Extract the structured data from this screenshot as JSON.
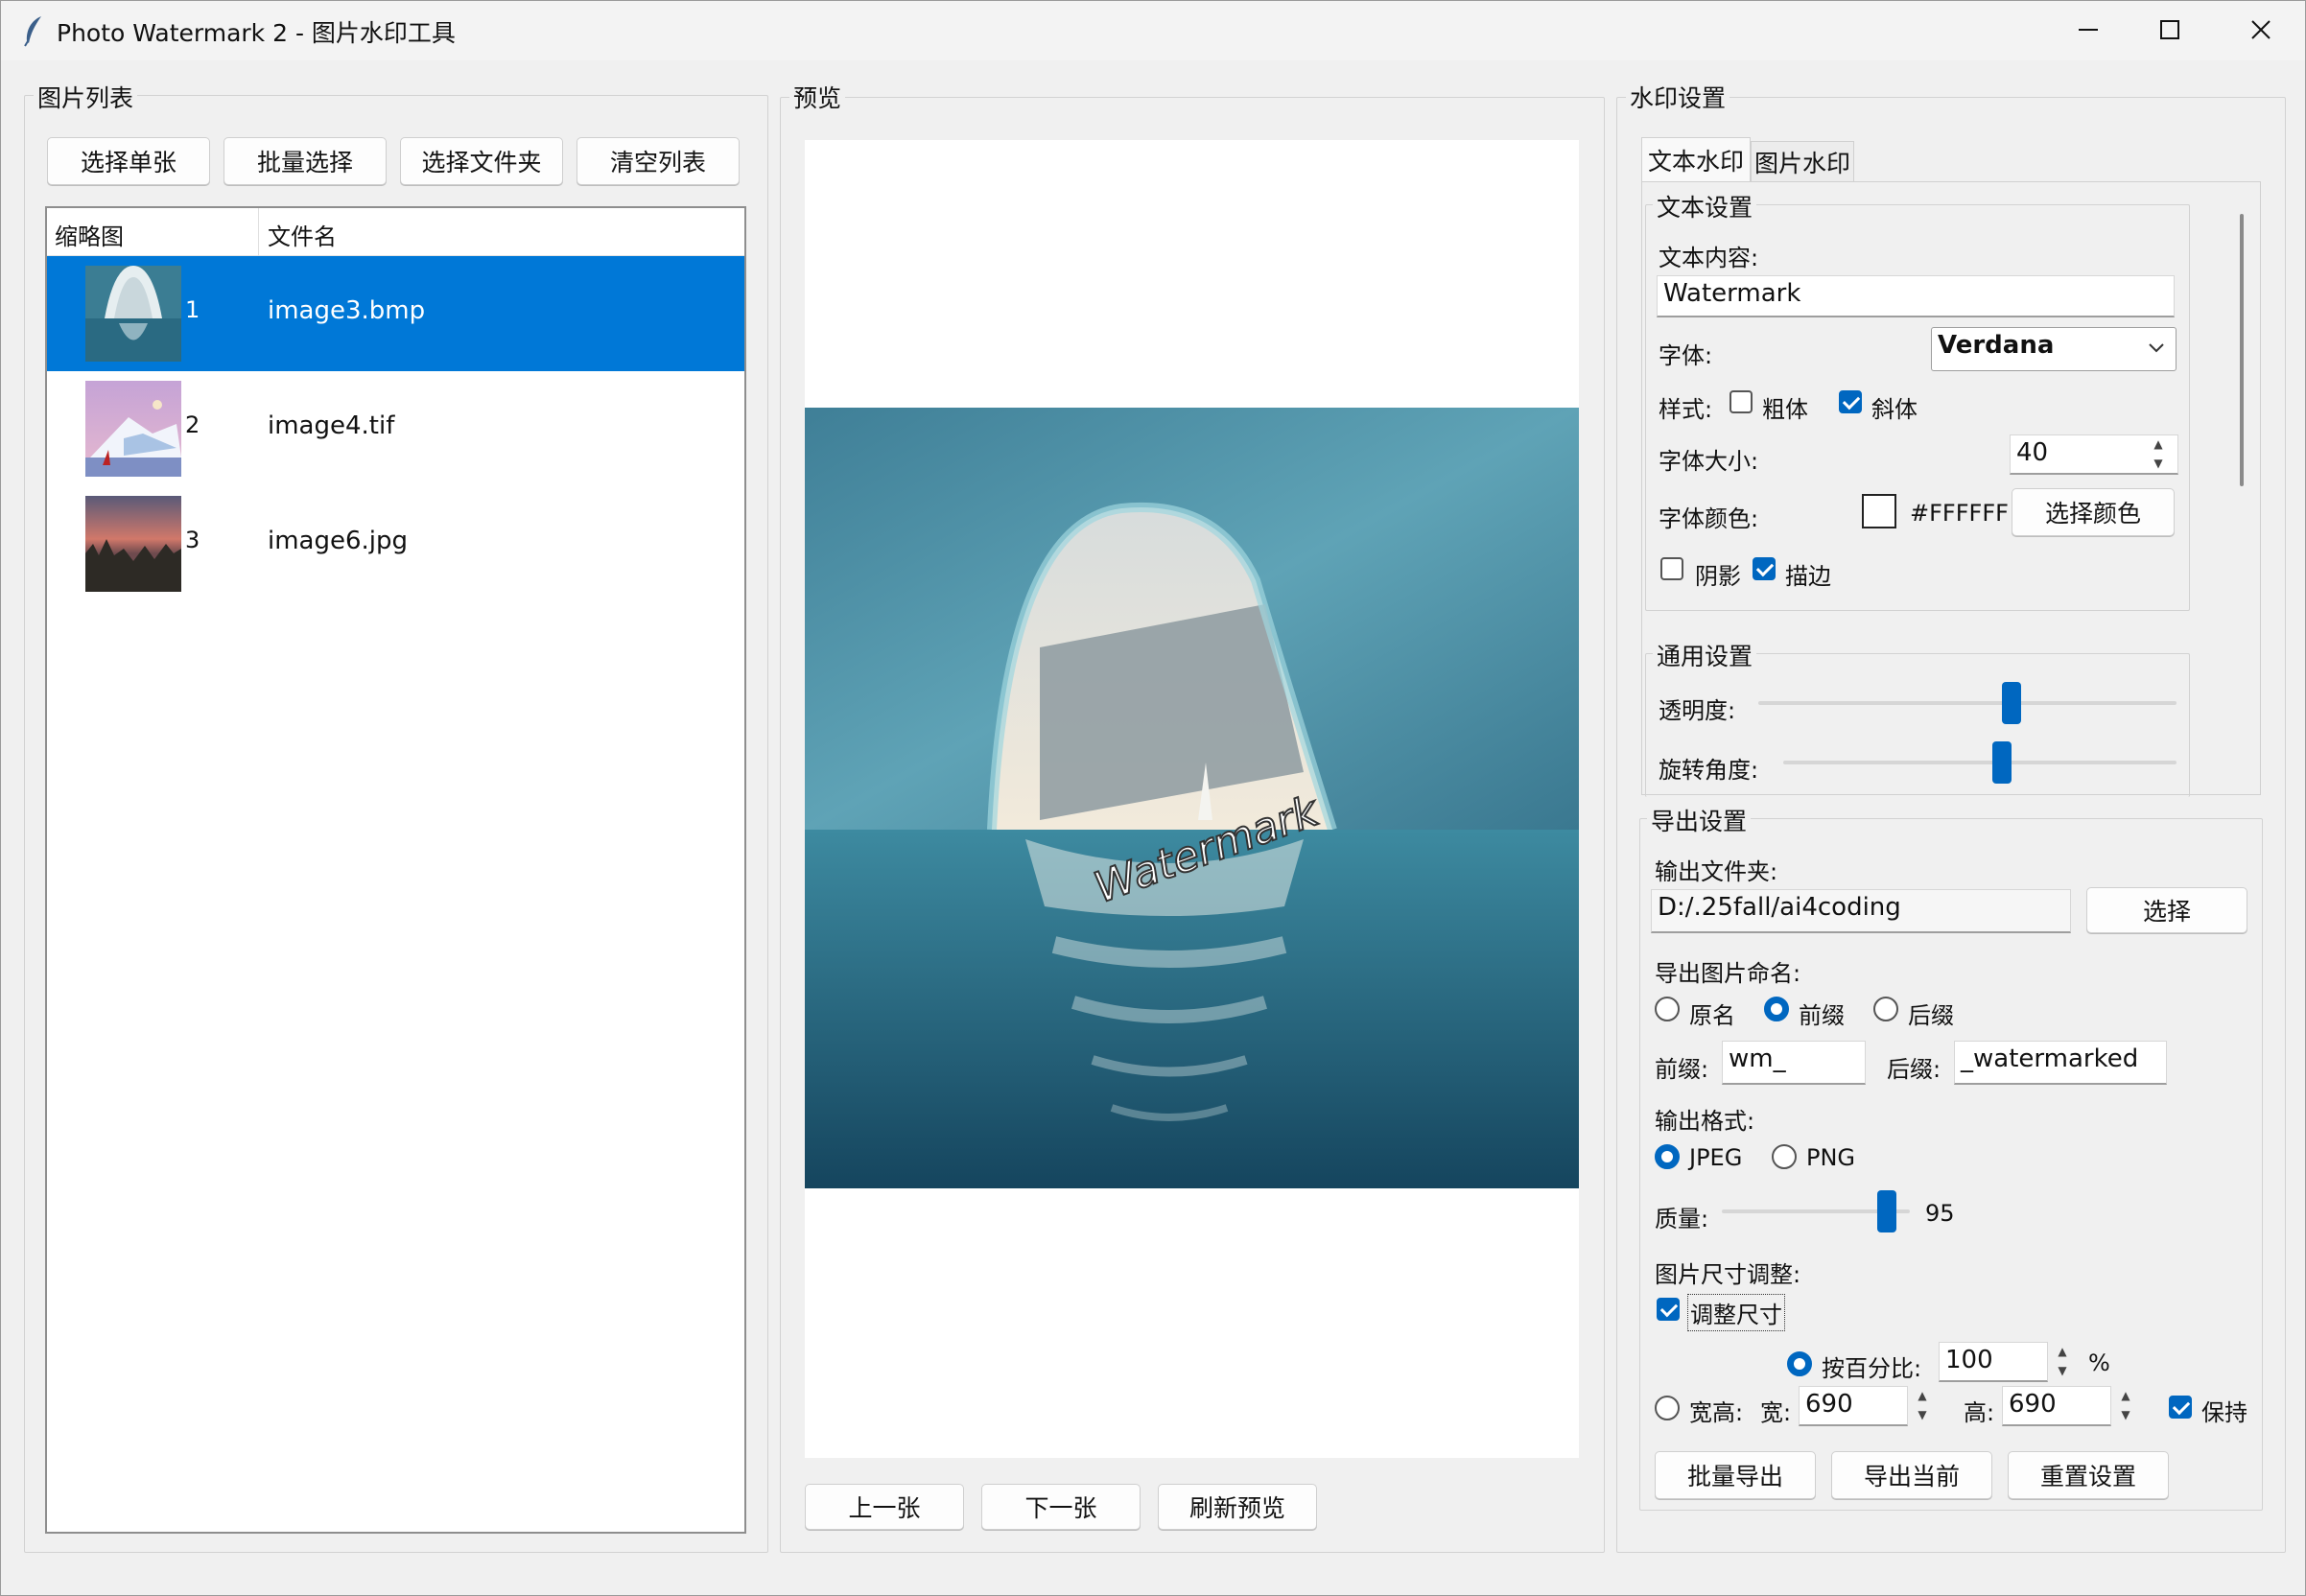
{
  "window": {
    "title": "Photo Watermark 2 - 图片水印工具"
  },
  "image_list": {
    "frame_label": "图片列表",
    "buttons": {
      "select_single": "选择单张",
      "batch_select": "批量选择",
      "select_folder": "选择文件夹",
      "clear_list": "清空列表"
    },
    "columns": {
      "thumb": "缩略图",
      "filename": "文件名"
    },
    "rows": [
      {
        "index": "1",
        "filename": "image3.bmp",
        "selected": true
      },
      {
        "index": "2",
        "filename": "image4.tif",
        "selected": false
      },
      {
        "index": "3",
        "filename": "image6.jpg",
        "selected": false
      }
    ]
  },
  "preview": {
    "frame_label": "预览",
    "watermark_text": "Watermark",
    "buttons": {
      "prev": "上一张",
      "next": "下一张",
      "refresh": "刷新预览"
    }
  },
  "watermark_settings": {
    "frame_label": "水印设置",
    "tabs": {
      "text": "文本水印",
      "image": "图片水印"
    },
    "text_settings": {
      "frame_label": "文本设置",
      "content_label": "文本内容:",
      "content_value": "Watermark",
      "font_label": "字体:",
      "font_value": "Verdana",
      "style_label": "样式:",
      "bold_label": "粗体",
      "bold_checked": false,
      "italic_label": "斜体",
      "italic_checked": true,
      "size_label": "字体大小:",
      "size_value": "40",
      "color_label": "字体颜色:",
      "color_value": "#FFFFFF",
      "choose_color_button": "选择颜色",
      "shadow_label": "阴影",
      "shadow_checked": false,
      "outline_label": "描边",
      "outline_checked": true
    },
    "general_settings": {
      "frame_label": "通用设置",
      "opacity_label": "透明度:",
      "opacity_level": 0.58,
      "rotation_label": "旋转角度:",
      "rotation_level": 0.53
    }
  },
  "export_settings": {
    "frame_label": "导出设置",
    "output_folder_label": "输出文件夹:",
    "output_folder_value": "D:/.25fall/ai4coding",
    "choose_button": "选择",
    "naming_label": "导出图片命名:",
    "naming_options": [
      "原名",
      "前缀",
      "后缀"
    ],
    "naming_selected": "前缀",
    "prefix_label": "前缀:",
    "prefix_value": "wm_",
    "suffix_label": "后缀:",
    "suffix_value": "_watermarked",
    "format_label": "输出格式:",
    "format_options": [
      "JPEG",
      "PNG"
    ],
    "format_selected": "JPEG",
    "quality_label": "质量:",
    "quality_value": "95",
    "resize_section_label": "图片尺寸调整:",
    "resize_checkbox_label": "调整尺寸",
    "resize_checked": true,
    "by_percent_label": "按百分比:",
    "percent_value": "100",
    "percent_unit": "%",
    "by_size_label": "宽高:",
    "width_label": "宽:",
    "width_value": "690",
    "height_label": "高:",
    "height_value": "690",
    "keep_label": "保持",
    "keep_checked": true,
    "buttons": {
      "batch_export": "批量导出",
      "export_current": "导出当前",
      "reset": "重置设置"
    }
  },
  "colors": {
    "accent": "#0067C0",
    "selection": "#0078D7",
    "window_bg": "#F0F0F0"
  }
}
